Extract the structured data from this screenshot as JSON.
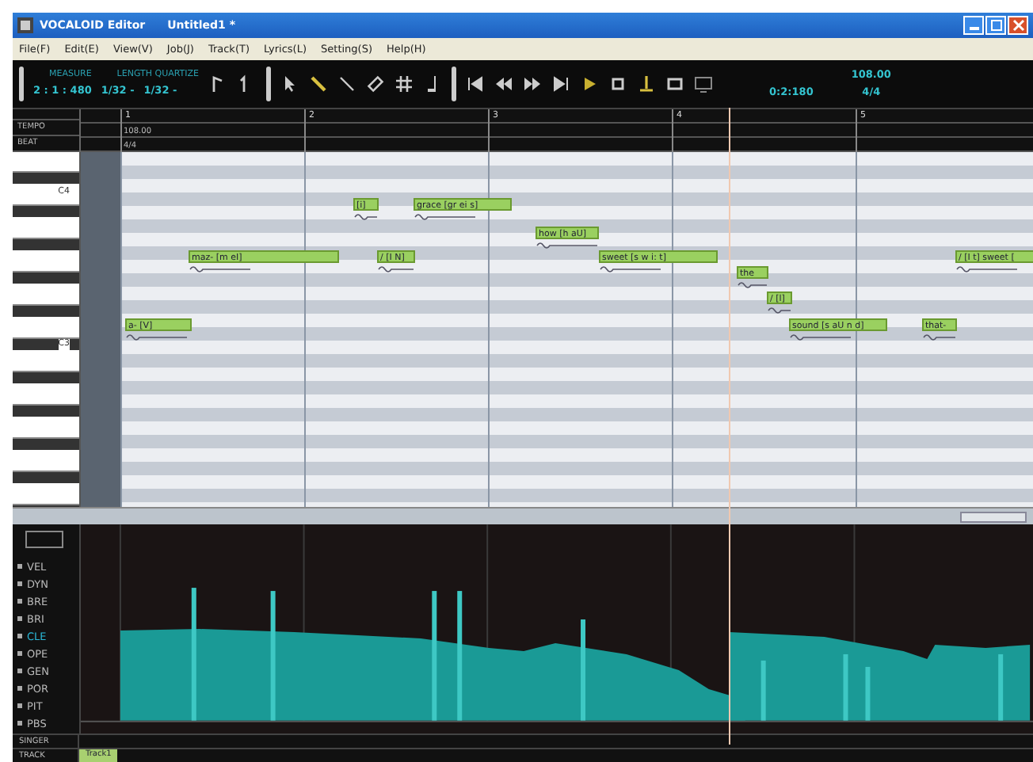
{
  "window": {
    "title": "VOCALOID Editor",
    "document": "Untitled1 *"
  },
  "menu": [
    "File(F)",
    "Edit(E)",
    "View(V)",
    "Job(J)",
    "Track(T)",
    "Lyrics(L)",
    "Setting(S)",
    "Help(H)"
  ],
  "toolbar": {
    "measure_label": "MEASURE",
    "measure": "2 : 1 : 480",
    "quantize_label": "LENGTH QUARTIZE",
    "length": "1/32 -",
    "quantize": "1/32 -",
    "time": "0:2:180",
    "tempo": "108.00",
    "beat": "4/4"
  },
  "ruler": {
    "measures": [
      "1",
      "2",
      "3",
      "4",
      "5"
    ],
    "tempo_label": "TEMPO",
    "tempo": "108.00",
    "beat_label": "BEAT",
    "beat": "4/4"
  },
  "keys": [
    "C4",
    "C3"
  ],
  "notes": [
    {
      "lyric": "a- [V]"
    },
    {
      "lyric": "maz- [m eI]"
    },
    {
      "lyric": "[i]"
    },
    {
      "lyric": "/ [I N]"
    },
    {
      "lyric": "grace [gr ei s]"
    },
    {
      "lyric": "how [h aU]"
    },
    {
      "lyric": "sweet [s w i: t]"
    },
    {
      "lyric": "the"
    },
    {
      "lyric": "/ [l]"
    },
    {
      "lyric": "sound [s aU n d]"
    },
    {
      "lyric": "that-"
    },
    {
      "lyric": "/ [I t] sweet ["
    }
  ],
  "parameters": [
    {
      "label": "VEL",
      "selected": false
    },
    {
      "label": "DYN",
      "selected": false
    },
    {
      "label": "BRE",
      "selected": false
    },
    {
      "label": "BRI",
      "selected": false
    },
    {
      "label": "CLE",
      "selected": true
    },
    {
      "label": "OPE",
      "selected": false
    },
    {
      "label": "GEN",
      "selected": false
    },
    {
      "label": "POR",
      "selected": false
    },
    {
      "label": "PIT",
      "selected": false
    },
    {
      "label": "PBS",
      "selected": false
    }
  ],
  "singer_label": "SINGER",
  "track_label": "TRACK",
  "tracks": [
    {
      "label": "Track1",
      "selected": true
    }
  ]
}
